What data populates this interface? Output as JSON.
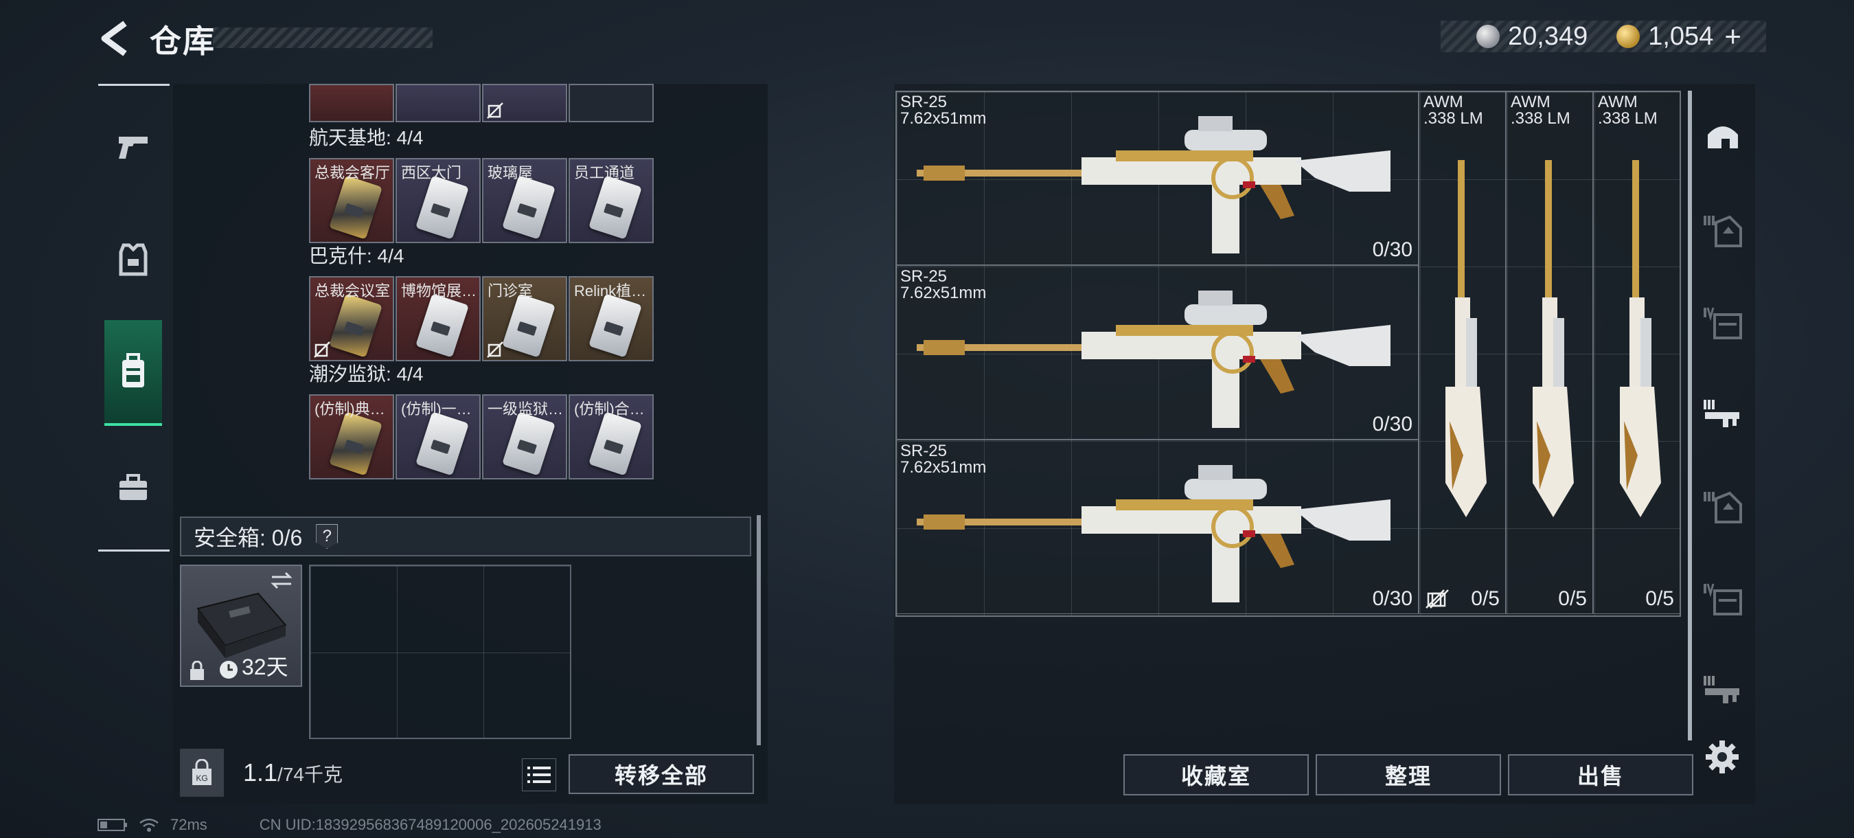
{
  "header": {
    "title": "仓库",
    "silver": "20,349",
    "gold": "1,054",
    "plus": "+"
  },
  "left_panel": {
    "sections": [
      {
        "title": "航天基地: 4/4",
        "cards": [
          {
            "label": "总裁会客厅",
            "bg": "red",
            "gold": true,
            "nosell": false
          },
          {
            "label": "西区大门",
            "bg": "purple",
            "gold": false,
            "nosell": false
          },
          {
            "label": "玻璃屋",
            "bg": "purple",
            "gold": false,
            "nosell": false
          },
          {
            "label": "员工通道",
            "bg": "purple",
            "gold": false,
            "nosell": false
          }
        ]
      },
      {
        "title": "巴克什: 4/4",
        "cards": [
          {
            "label": "总裁会议室",
            "bg": "red",
            "gold": true,
            "nosell": true
          },
          {
            "label": "博物馆展…",
            "bg": "red",
            "gold": false,
            "nosell": false
          },
          {
            "label": "门诊室",
            "bg": "brown",
            "gold": false,
            "nosell": true
          },
          {
            "label": "Relink植…",
            "bg": "brown",
            "gold": false,
            "nosell": false
          }
        ]
      },
      {
        "title": "潮汐监狱: 4/4",
        "cards": [
          {
            "label": "(仿制)典…",
            "bg": "red",
            "gold": true,
            "nosell": false
          },
          {
            "label": "(仿制)一…",
            "bg": "purple",
            "gold": false,
            "nosell": false
          },
          {
            "label": "一级监狱…",
            "bg": "purple",
            "gold": false,
            "nosell": false
          },
          {
            "label": "(仿制)合…",
            "bg": "purple",
            "gold": false,
            "nosell": false
          }
        ]
      }
    ],
    "safe_box": {
      "label": "安全箱: 0/6",
      "help": "?",
      "duration": "32天"
    },
    "weight": {
      "current": "1.1",
      "max": "/74千克",
      "kg_icon_label": "KG"
    },
    "transfer_all": "转移全部"
  },
  "weapons": [
    {
      "name": "SR-25",
      "caliber": "7.62x51mm",
      "ammo": "0/30",
      "nosell": false
    },
    {
      "name": "SR-25",
      "caliber": "7.62x51mm",
      "ammo": "0/30",
      "nosell": false
    },
    {
      "name": "SR-25",
      "caliber": "7.62x51mm",
      "ammo": "0/30",
      "nosell": true
    },
    {
      "name": "AWM",
      "caliber": ".338 LM",
      "ammo": "0/5",
      "nosell": true
    },
    {
      "name": "AWM",
      "caliber": ".338 LM",
      "ammo": "0/5",
      "nosell": false
    },
    {
      "name": "AWM",
      "caliber": ".338 LM",
      "ammo": "0/5",
      "nosell": false
    }
  ],
  "right_tabs": [
    "home",
    "level-3-armor",
    "level-4-bag",
    "level-3-gun",
    "level-3-armor",
    "level-4-bag",
    "level-3-gun"
  ],
  "right_buttons": {
    "collection": "收藏室",
    "organize": "整理",
    "sell": "出售"
  },
  "status": {
    "ping": "72ms",
    "uid": "CN UID:1839295683674891200​06_202605241913"
  },
  "colors": {
    "accent_green": "#3fe0a2",
    "gold": "#c9a24a"
  }
}
